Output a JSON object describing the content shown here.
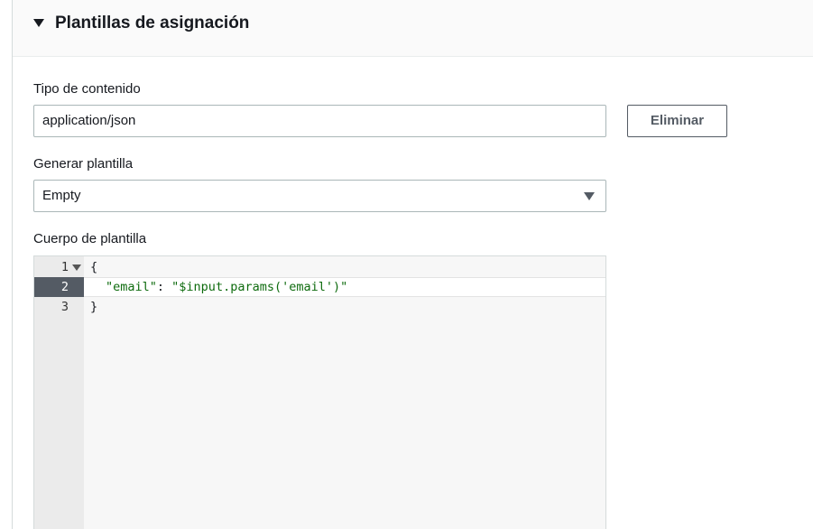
{
  "section": {
    "title": "Plantillas de asignación",
    "expand_icon": "caret-down-icon"
  },
  "content_type": {
    "label": "Tipo de contenido",
    "value": "application/json",
    "delete_label": "Eliminar"
  },
  "generate_template": {
    "label": "Generar plantilla",
    "selected": "Empty",
    "icon": "caret-down-icon"
  },
  "template_body": {
    "label": "Cuerpo de plantilla",
    "active_line": 2,
    "lines": [
      {
        "number": "1",
        "text": "{"
      },
      {
        "number": "2",
        "key": "\"email\"",
        "sep": ": ",
        "value": "\"$input.params('email')\""
      },
      {
        "number": "3",
        "text": "}"
      }
    ]
  },
  "colors": {
    "string": "#0e6b0e",
    "active_gutter": "#545b64",
    "button_border": "#545b64"
  }
}
